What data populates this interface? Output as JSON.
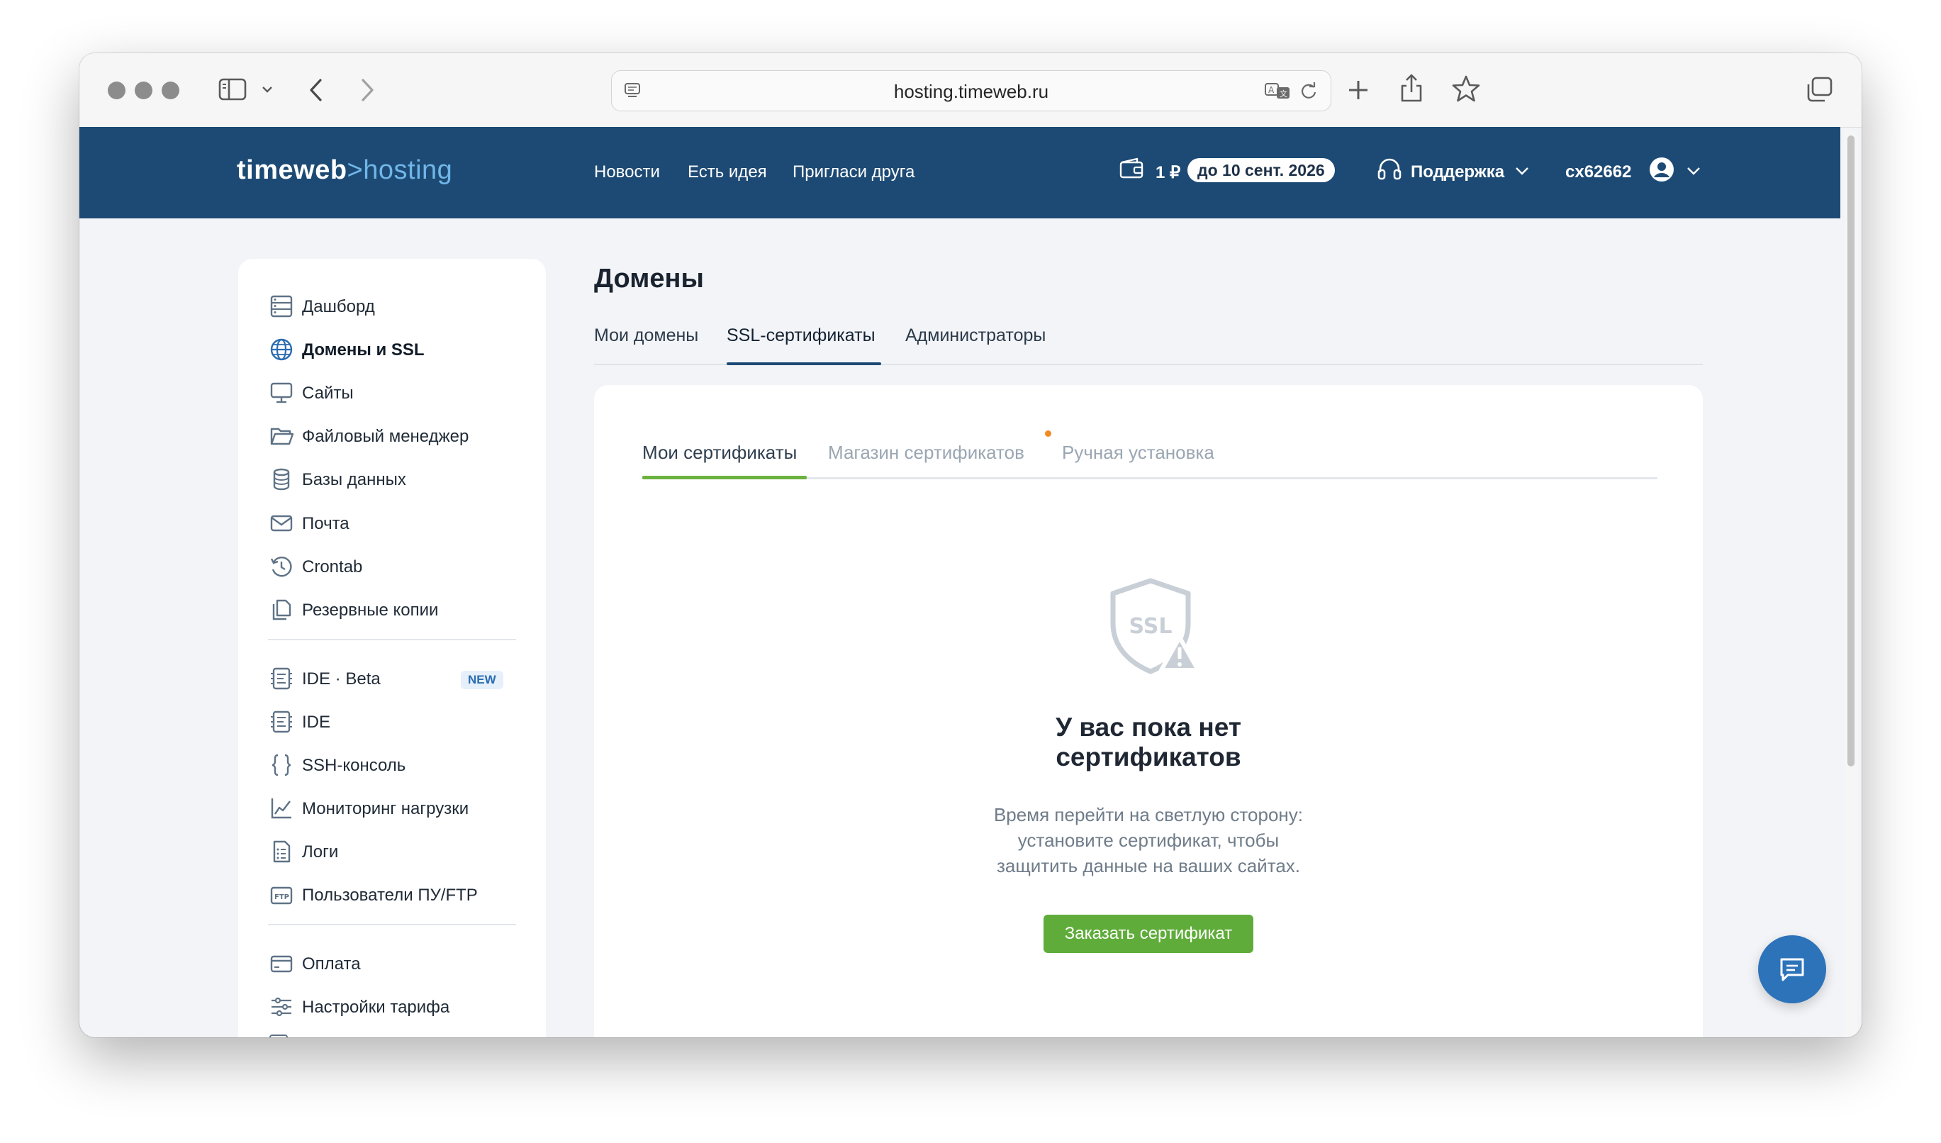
{
  "browser": {
    "url": "hosting.timeweb.ru"
  },
  "header": {
    "logo_main": "timeweb",
    "logo_sep": ">",
    "logo_sub": "hosting",
    "nav": [
      "Новости",
      "Есть идея",
      "Пригласи друга"
    ],
    "balance": "1 ₽",
    "paid_until": "до 10 сент. 2026",
    "support": "Поддержка",
    "account": "cx62662",
    "bg_color": "#1d4a74"
  },
  "sidebar": {
    "items": [
      {
        "label": "Дашборд",
        "icon": "dashboard-icon"
      },
      {
        "label": "Домены и SSL",
        "icon": "globe-icon",
        "active": true
      },
      {
        "label": "Сайты",
        "icon": "monitor-icon"
      },
      {
        "label": "Файловый менеджер",
        "icon": "folder-icon"
      },
      {
        "label": "Базы данных",
        "icon": "database-icon"
      },
      {
        "label": "Почта",
        "icon": "mail-icon"
      },
      {
        "label": "Crontab",
        "icon": "history-icon"
      },
      {
        "label": "Резервные копии",
        "icon": "copies-icon"
      },
      {
        "label": "IDE · Beta",
        "icon": "code-icon",
        "badge": "NEW"
      },
      {
        "label": "IDE",
        "icon": "code-icon"
      },
      {
        "label": "SSH-консоль",
        "icon": "braces-icon"
      },
      {
        "label": "Мониторинг нагрузки",
        "icon": "chart-icon"
      },
      {
        "label": "Логи",
        "icon": "log-icon"
      },
      {
        "label": "Пользователи ПУ/FTP",
        "icon": "ftp-icon"
      },
      {
        "label": "Оплата",
        "icon": "card-icon"
      },
      {
        "label": "Настройки тарифа",
        "icon": "sliders-icon"
      }
    ]
  },
  "main": {
    "title": "Домены",
    "tabs": [
      "Мои домены",
      "SSL-сертификаты",
      "Администраторы"
    ],
    "active_tab": 1,
    "subtabs": [
      "Мои сертификаты",
      "Магазин сертификатов",
      "Ручная установка"
    ],
    "active_subtab": 0,
    "empty_icon_text": "SSL",
    "empty_title": "У вас пока нет сертификатов",
    "empty_title_line1": "У вас пока нет",
    "empty_title_line2": "сертификатов",
    "empty_desc_line1": "Время перейти на светлую сторону:",
    "empty_desc_line2": "установите сертификат, чтобы",
    "empty_desc_line3": "защитить данные на ваших сайтах.",
    "order_button": "Заказать сертификат",
    "accent_green": "#5fac3a",
    "accent_orange": "#f08a24"
  }
}
